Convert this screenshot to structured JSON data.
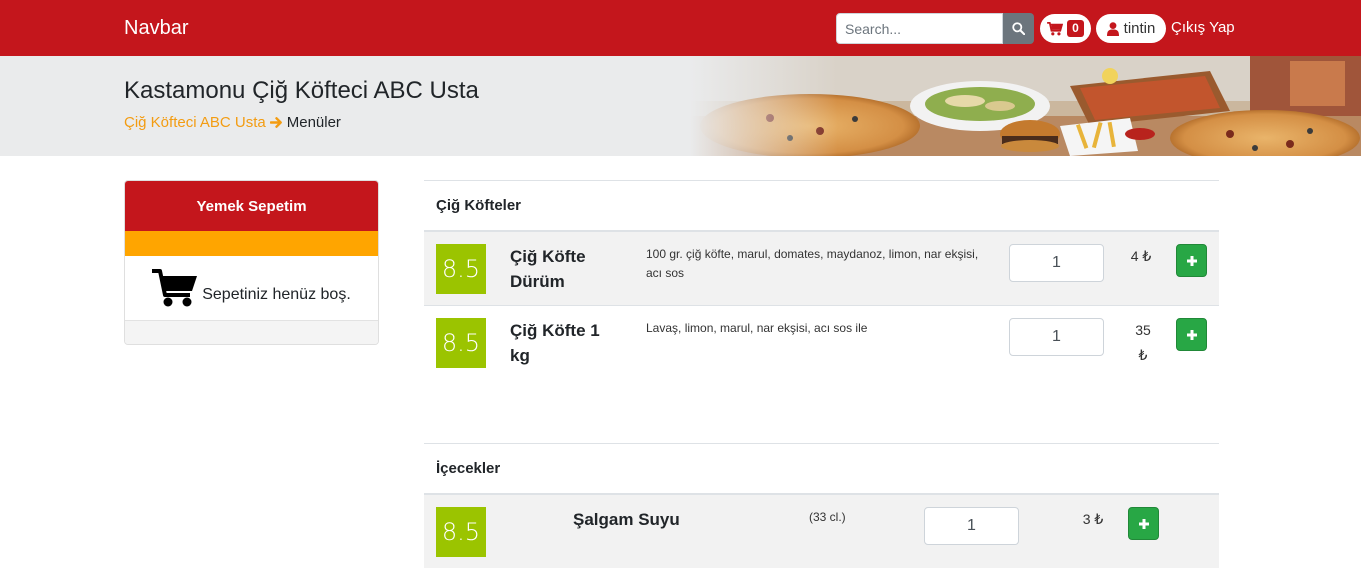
{
  "navbar": {
    "brand": "Navbar",
    "search_placeholder": "Search...",
    "cart_count": "0",
    "username": "tintin",
    "logout_label": "Çıkış Yap"
  },
  "hero": {
    "title": "Kastamonu Çiğ Köfteci ABC Usta",
    "breadcrumb_link": "Çiğ Köfteci ABC Usta",
    "breadcrumb_current": "Menüler"
  },
  "cart": {
    "header": "Yemek Sepetim",
    "empty_text": "Sepetiniz henüz boş."
  },
  "menu": {
    "sections": [
      {
        "title": "Çiğ Köfteler",
        "items": [
          {
            "rating": "8.5",
            "name": "Çiğ Köfte Dürüm",
            "description": "100 gr. çiğ köfte, marul, domates, maydanoz, limon, nar ekşisi, acı sos",
            "quantity": "1",
            "price": "4 ₺"
          },
          {
            "rating": "8.5",
            "name": "Çiğ Köfte 1 kg",
            "description": "Lavaş, limon, marul, nar ekşisi, acı sos ile",
            "quantity": "1",
            "price": "35 ₺"
          }
        ]
      },
      {
        "title": "İçecekler",
        "items": [
          {
            "rating": "8.5",
            "name": "Şalgam Suyu",
            "description": "(33 cl.)",
            "quantity": "1",
            "price": "3 ₺"
          }
        ]
      }
    ]
  },
  "icons": {
    "search": "search-icon",
    "cart": "shopping-cart-icon",
    "user": "user-icon",
    "arrow": "arrow-right-icon",
    "plus": "plus-icon"
  },
  "colors": {
    "brand_red": "#c4161c",
    "accent_orange": "#ffa500",
    "rating_green": "#9bc400",
    "add_green": "#28a745",
    "breadcrumb_link": "#f39c12"
  }
}
